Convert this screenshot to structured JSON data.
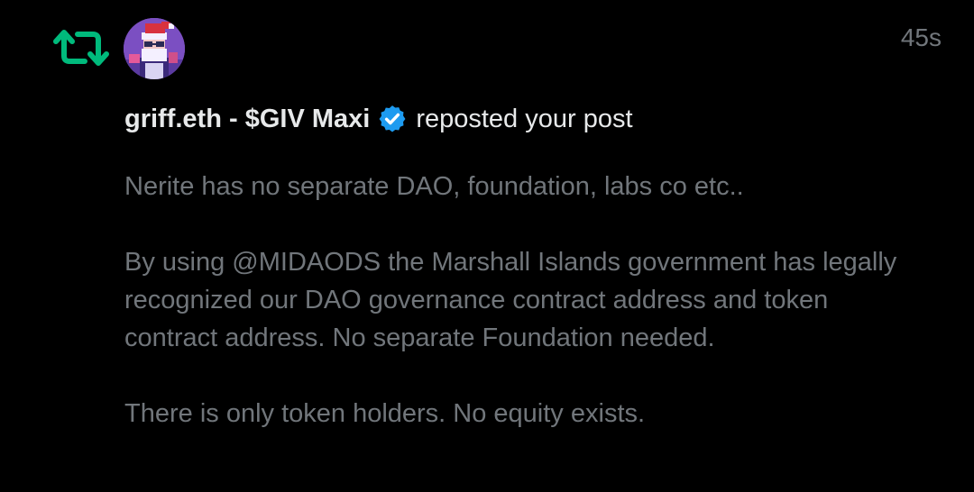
{
  "notification": {
    "type": "repost",
    "timestamp": "45s",
    "author": {
      "name": "griff.eth - $GIV Maxi",
      "verified": true
    },
    "action_text": "reposted your post",
    "post": {
      "paragraphs": [
        "Nerite has no separate DAO, foundation, labs co etc..",
        "By using @MIDAODS the Marshall Islands government has legally recognized our DAO governance contract address and token contract address. No separate Foundation needed.",
        "There is only token holders. No equity exists."
      ]
    }
  },
  "icons": {
    "repost": "repost-icon",
    "avatar": "avatar-santa-icon",
    "verified": "verified-badge-icon"
  },
  "colors": {
    "background": "#000000",
    "repost_green": "#00ba7c",
    "verified_blue": "#1d9bf0",
    "primary_text": "#e7e9ea",
    "secondary_text": "#71767b"
  }
}
